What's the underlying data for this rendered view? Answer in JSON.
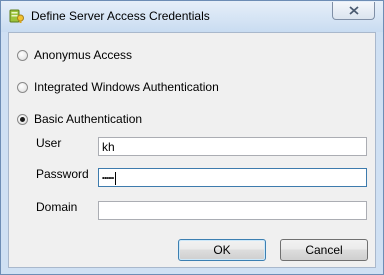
{
  "window": {
    "title": "Define Server Access Credentials",
    "icon": "server-keys-icon"
  },
  "auth_options": [
    {
      "label": "Anonymus Access",
      "selected": false
    },
    {
      "label": "Integrated Windows Authentication",
      "selected": false
    },
    {
      "label": "Basic Authentication",
      "selected": true
    }
  ],
  "fields": {
    "user": {
      "label": "User",
      "value": "kh"
    },
    "password": {
      "label": "Password",
      "value": "••••••"
    },
    "domain": {
      "label": "Domain",
      "value": ""
    }
  },
  "buttons": {
    "ok": "OK",
    "cancel": "Cancel"
  },
  "colors": {
    "title_bar": "#c9dcf1",
    "frame": "#cfe0f3",
    "client": "#f0f0f0"
  }
}
